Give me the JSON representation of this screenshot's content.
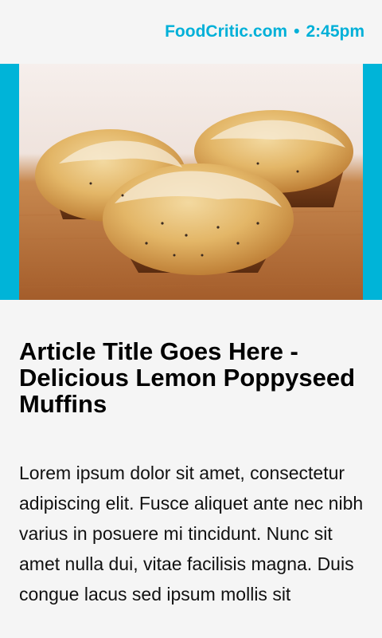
{
  "header": {
    "site": "FoodCritic.com",
    "separator": "•",
    "time": "2:45pm"
  },
  "hero": {
    "image_icon": "muffin-photo"
  },
  "article": {
    "title": "Article Title Goes Here - Delicious Lemon Poppyseed Muffins",
    "body": "Lorem ipsum dolor sit amet, consectetur adipiscing elit. Fusce aliquet ante nec nibh varius in posuere mi tincidunt. Nunc sit amet nulla dui, vitae facilisis magna. Duis congue lacus sed ipsum mollis sit"
  },
  "colors": {
    "accent": "#00b4d8",
    "header_text": "#00b0d8",
    "background": "#f5f5f5"
  }
}
